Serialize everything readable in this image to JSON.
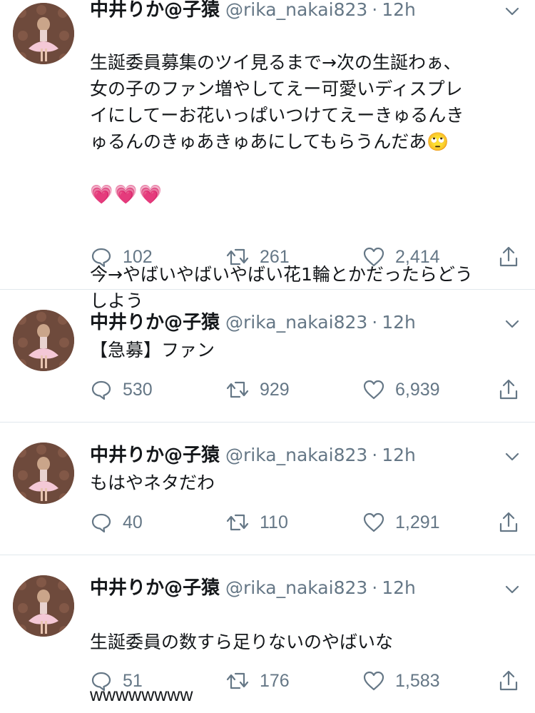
{
  "tweets": [
    {
      "name": "中井りか@子猿",
      "handle": "@rika_nakai823",
      "separator": "·",
      "time": "12h",
      "text": "生誕委員募集のツイ見るまで→次の生誕わぁ、\n女の子のファン増やしてえー可愛いディスプレ\nイにしてーお花いっぱいつけてえーきゅるんき\nゅるんのきゅあきゅあにしてもらうんだあ🙄",
      "hearts": "💗💗💗",
      "text2": "今→やばいやばいやばい花1輪とかだったらどう\nしよう",
      "replies": "102",
      "retweets": "261",
      "likes": "2,414"
    },
    {
      "name": "中井りか@子猿",
      "handle": "@rika_nakai823",
      "separator": "·",
      "time": "12h",
      "text": "【急募】ファン",
      "replies": "530",
      "retweets": "929",
      "likes": "6,939"
    },
    {
      "name": "中井りか@子猿",
      "handle": "@rika_nakai823",
      "separator": "·",
      "time": "12h",
      "text": "もはやネタだわ",
      "replies": "40",
      "retweets": "110",
      "likes": "1,291"
    },
    {
      "name": "中井りか@子猿",
      "handle": "@rika_nakai823",
      "separator": "·",
      "time": "12h",
      "text": "生誕委員の数すら足りないのやばいな",
      "text2": "wwwwwwww",
      "replies": "51",
      "retweets": "176",
      "likes": "1,583"
    }
  ],
  "icons": {
    "reply": "reply-icon",
    "retweet": "retweet-icon",
    "like": "heart-icon",
    "share": "share-icon",
    "caret": "chevron-down-icon"
  },
  "colors": {
    "text": "#14171a",
    "secondary": "#657786",
    "divider": "#e1e8ed",
    "avatar_bg": "#6e4a3c"
  }
}
